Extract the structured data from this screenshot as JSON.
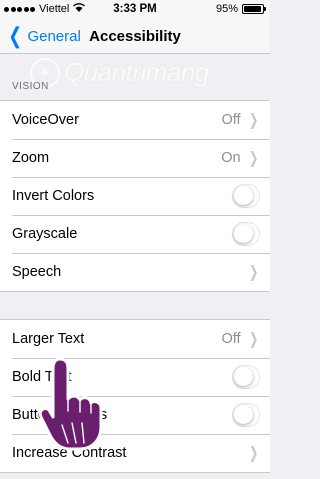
{
  "status_bar": {
    "carrier": "Viettel",
    "time": "3:33 PM",
    "battery": "95%",
    "battery_level": 0.95,
    "signal_icon": "signal-dots-icon",
    "wifi_icon": "wifi-icon"
  },
  "nav": {
    "back_label": "General",
    "title": "Accessibility"
  },
  "vision_section": {
    "header": "VISION",
    "rows": [
      {
        "label": "VoiceOver",
        "value": "Off",
        "control": "chevron"
      },
      {
        "label": "Zoom",
        "value": "On",
        "control": "chevron"
      },
      {
        "label": "Invert Colors",
        "value": "",
        "control": "switch-off"
      },
      {
        "label": "Grayscale",
        "value": "",
        "control": "switch-off"
      },
      {
        "label": "Speech",
        "value": "",
        "control": "chevron"
      }
    ]
  },
  "text_section": {
    "rows": [
      {
        "label": "Larger Text",
        "value": "Off",
        "control": "chevron"
      },
      {
        "label": "Bold Text",
        "value": "",
        "control": "switch-off"
      },
      {
        "label": "Button Shapes",
        "value": "",
        "control": "switch-off"
      },
      {
        "label": "Increase Contrast",
        "value": "",
        "control": "chevron"
      }
    ]
  },
  "watermark": {
    "text": "Quantrimang"
  },
  "colors": {
    "accent": "#007aff",
    "background": "#efeff4",
    "separator": "#c8c7cc",
    "secondary_text": "#8e8e93"
  }
}
